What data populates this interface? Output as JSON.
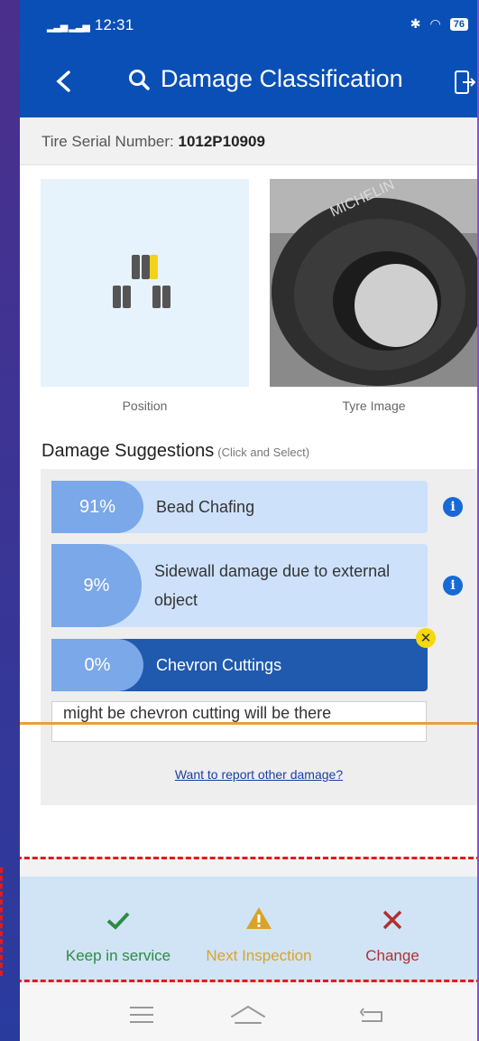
{
  "status_bar": {
    "time": "12:31",
    "signal": "....  ....",
    "battery": "76"
  },
  "header": {
    "title": "Damage Classification"
  },
  "serial": {
    "label": "Tire Serial Number:",
    "value": "1012P10909"
  },
  "images": {
    "position_caption": "Position",
    "tyre_caption": "Tyre Image",
    "tyre_brand_text": "MICHELIN"
  },
  "suggestions": {
    "title": "Damage Suggestions",
    "hint": "(Click and Select)",
    "items": [
      {
        "percent": "91%",
        "label": "Bead Chafing"
      },
      {
        "percent": "9%",
        "label": "Sidewall damage due to external object"
      },
      {
        "percent": "0%",
        "label": "Chevron Cuttings"
      }
    ],
    "note": "might be chevron cutting will be there",
    "report_link": "Want to report other damage?"
  },
  "actions": [
    {
      "label": "Keep in service",
      "icon": "check-icon",
      "color": "#2f8a44"
    },
    {
      "label": "Next Inspection",
      "icon": "warning-icon",
      "color": "#d9a32a"
    },
    {
      "label": "Change",
      "icon": "close-icon",
      "color": "#b03030"
    }
  ],
  "colors": {
    "primary": "#0a4fb5",
    "selected_item": "#1f5aae",
    "item_bg": "#cde1fb",
    "percent_bg": "#7aa8e8"
  }
}
